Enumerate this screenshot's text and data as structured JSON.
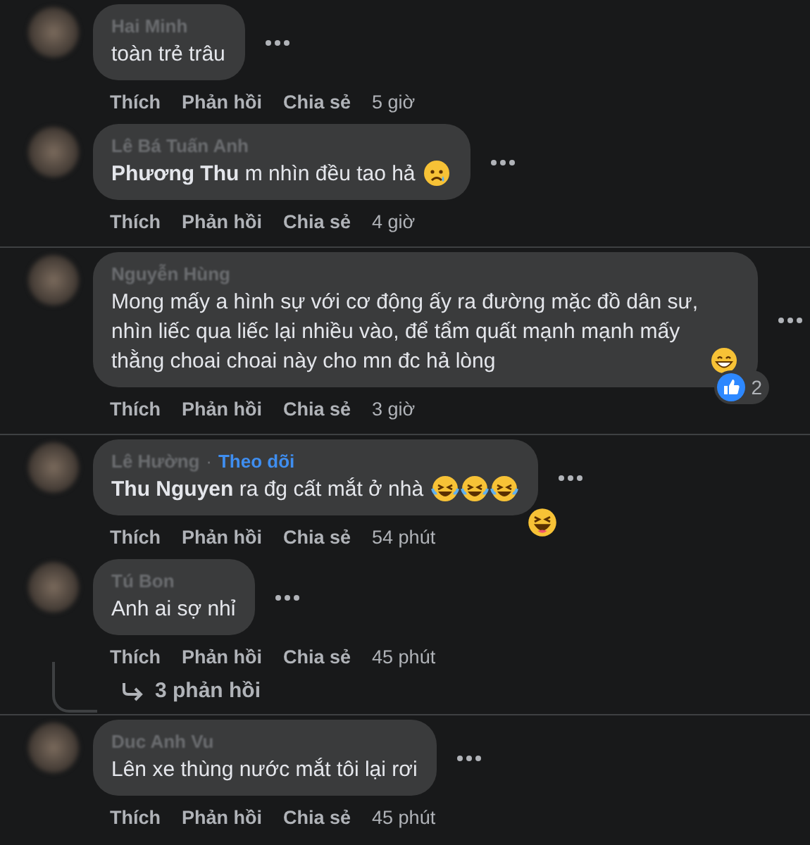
{
  "threads": [
    {
      "comments": [
        {
          "name": "Hai Minh",
          "text": "toàn trẻ trâu",
          "actions": [
            "Thích",
            "Phản hồi",
            "Chia sẻ"
          ],
          "time": "5 giờ"
        },
        {
          "name": "Lê Bá Tuấn Anh",
          "text": "**Phương Thu** m nhìn đều tao hả",
          "emoji": [
            {
              "kind": "sad"
            }
          ],
          "actions": [
            "Thích",
            "Phản hồi",
            "Chia sẻ"
          ],
          "time": "4 giờ"
        }
      ]
    },
    {
      "comments": [
        {
          "name": "Nguyễn Hùng",
          "text": "Mong mấy a hình sự với cơ động ấy ra đường mặc đồ dân sư, nhìn liếc qua liếc lại nhiều vào, để tẩm quất mạnh mạnh mấy thằng choai choai này cho mn đc hả lòng",
          "emoji": [
            {
              "kind": "grin"
            }
          ],
          "reaction": {
            "kind": "like",
            "count": "2"
          },
          "actions": [
            "Thích",
            "Phản hồi",
            "Chia sẻ"
          ],
          "time": "3 giờ"
        }
      ]
    },
    {
      "comments": [
        {
          "name": "Lê Hường",
          "separator": "·",
          "follow": "Theo dõi",
          "text": "**Thu Nguyen** ra đg cất mắt ở nhà",
          "emoji": [
            {
              "kind": "laugh-cry"
            },
            {
              "kind": "laugh-cry"
            },
            {
              "kind": "laugh-cry"
            }
          ],
          "reaction": {
            "kind": "haha"
          },
          "actions": [
            "Thích",
            "Phản hồi",
            "Chia sẻ"
          ],
          "time": "54 phút"
        },
        {
          "name": "Tú Bon",
          "text": "Anh ai sợ nhỉ",
          "actions": [
            "Thích",
            "Phản hồi",
            "Chia sẻ"
          ],
          "time": "45 phút"
        }
      ],
      "replies": "3 phản hồi"
    },
    {
      "comments": [
        {
          "name": "Duc Anh Vu",
          "text": "Lên xe thùng nước mắt tôi lại rơi",
          "actions": [
            "Thích",
            "Phản hồi",
            "Chia sẻ"
          ],
          "time": "45 phút"
        }
      ]
    }
  ]
}
